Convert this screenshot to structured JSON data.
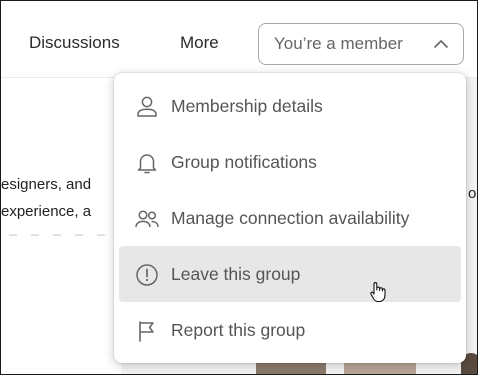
{
  "nav": {
    "discussions_label": "Discussions",
    "more_label": "More",
    "membership_button_label": "You’re a member"
  },
  "background": {
    "text_line_1": "esigners, and",
    "text_line_2": "experience, a",
    "right_letter": "o"
  },
  "menu": {
    "items": [
      {
        "label": "Membership details",
        "icon": "person-icon"
      },
      {
        "label": "Group notifications",
        "icon": "bell-icon"
      },
      {
        "label": "Manage connection availability",
        "icon": "people-icon"
      },
      {
        "label": "Leave this group",
        "icon": "alert-circle-icon",
        "hovered": true
      },
      {
        "label": "Report this group",
        "icon": "flag-icon"
      }
    ]
  },
  "colors": {
    "text": "#2b2b2b",
    "muted_text": "#555555",
    "hover_background": "#e7e7e7",
    "button_border": "#a8a8a8"
  }
}
